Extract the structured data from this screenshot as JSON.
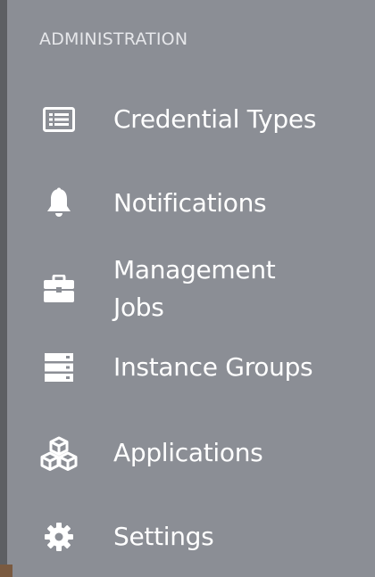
{
  "sidebar": {
    "section_title": "ADMINISTRATION",
    "items": [
      {
        "label": "Credential Types",
        "icon": "list-card-icon"
      },
      {
        "label": "Notifications",
        "icon": "bell-icon"
      },
      {
        "label": "Management Jobs",
        "icon": "briefcase-icon"
      },
      {
        "label": "Instance Groups",
        "icon": "server-stack-icon"
      },
      {
        "label": "Applications",
        "icon": "cubes-icon"
      },
      {
        "label": "Settings",
        "icon": "gear-icon"
      }
    ]
  },
  "colors": {
    "sidebar_bg": "#8b8e95",
    "border": "#5d5f63",
    "text": "#ffffff"
  }
}
